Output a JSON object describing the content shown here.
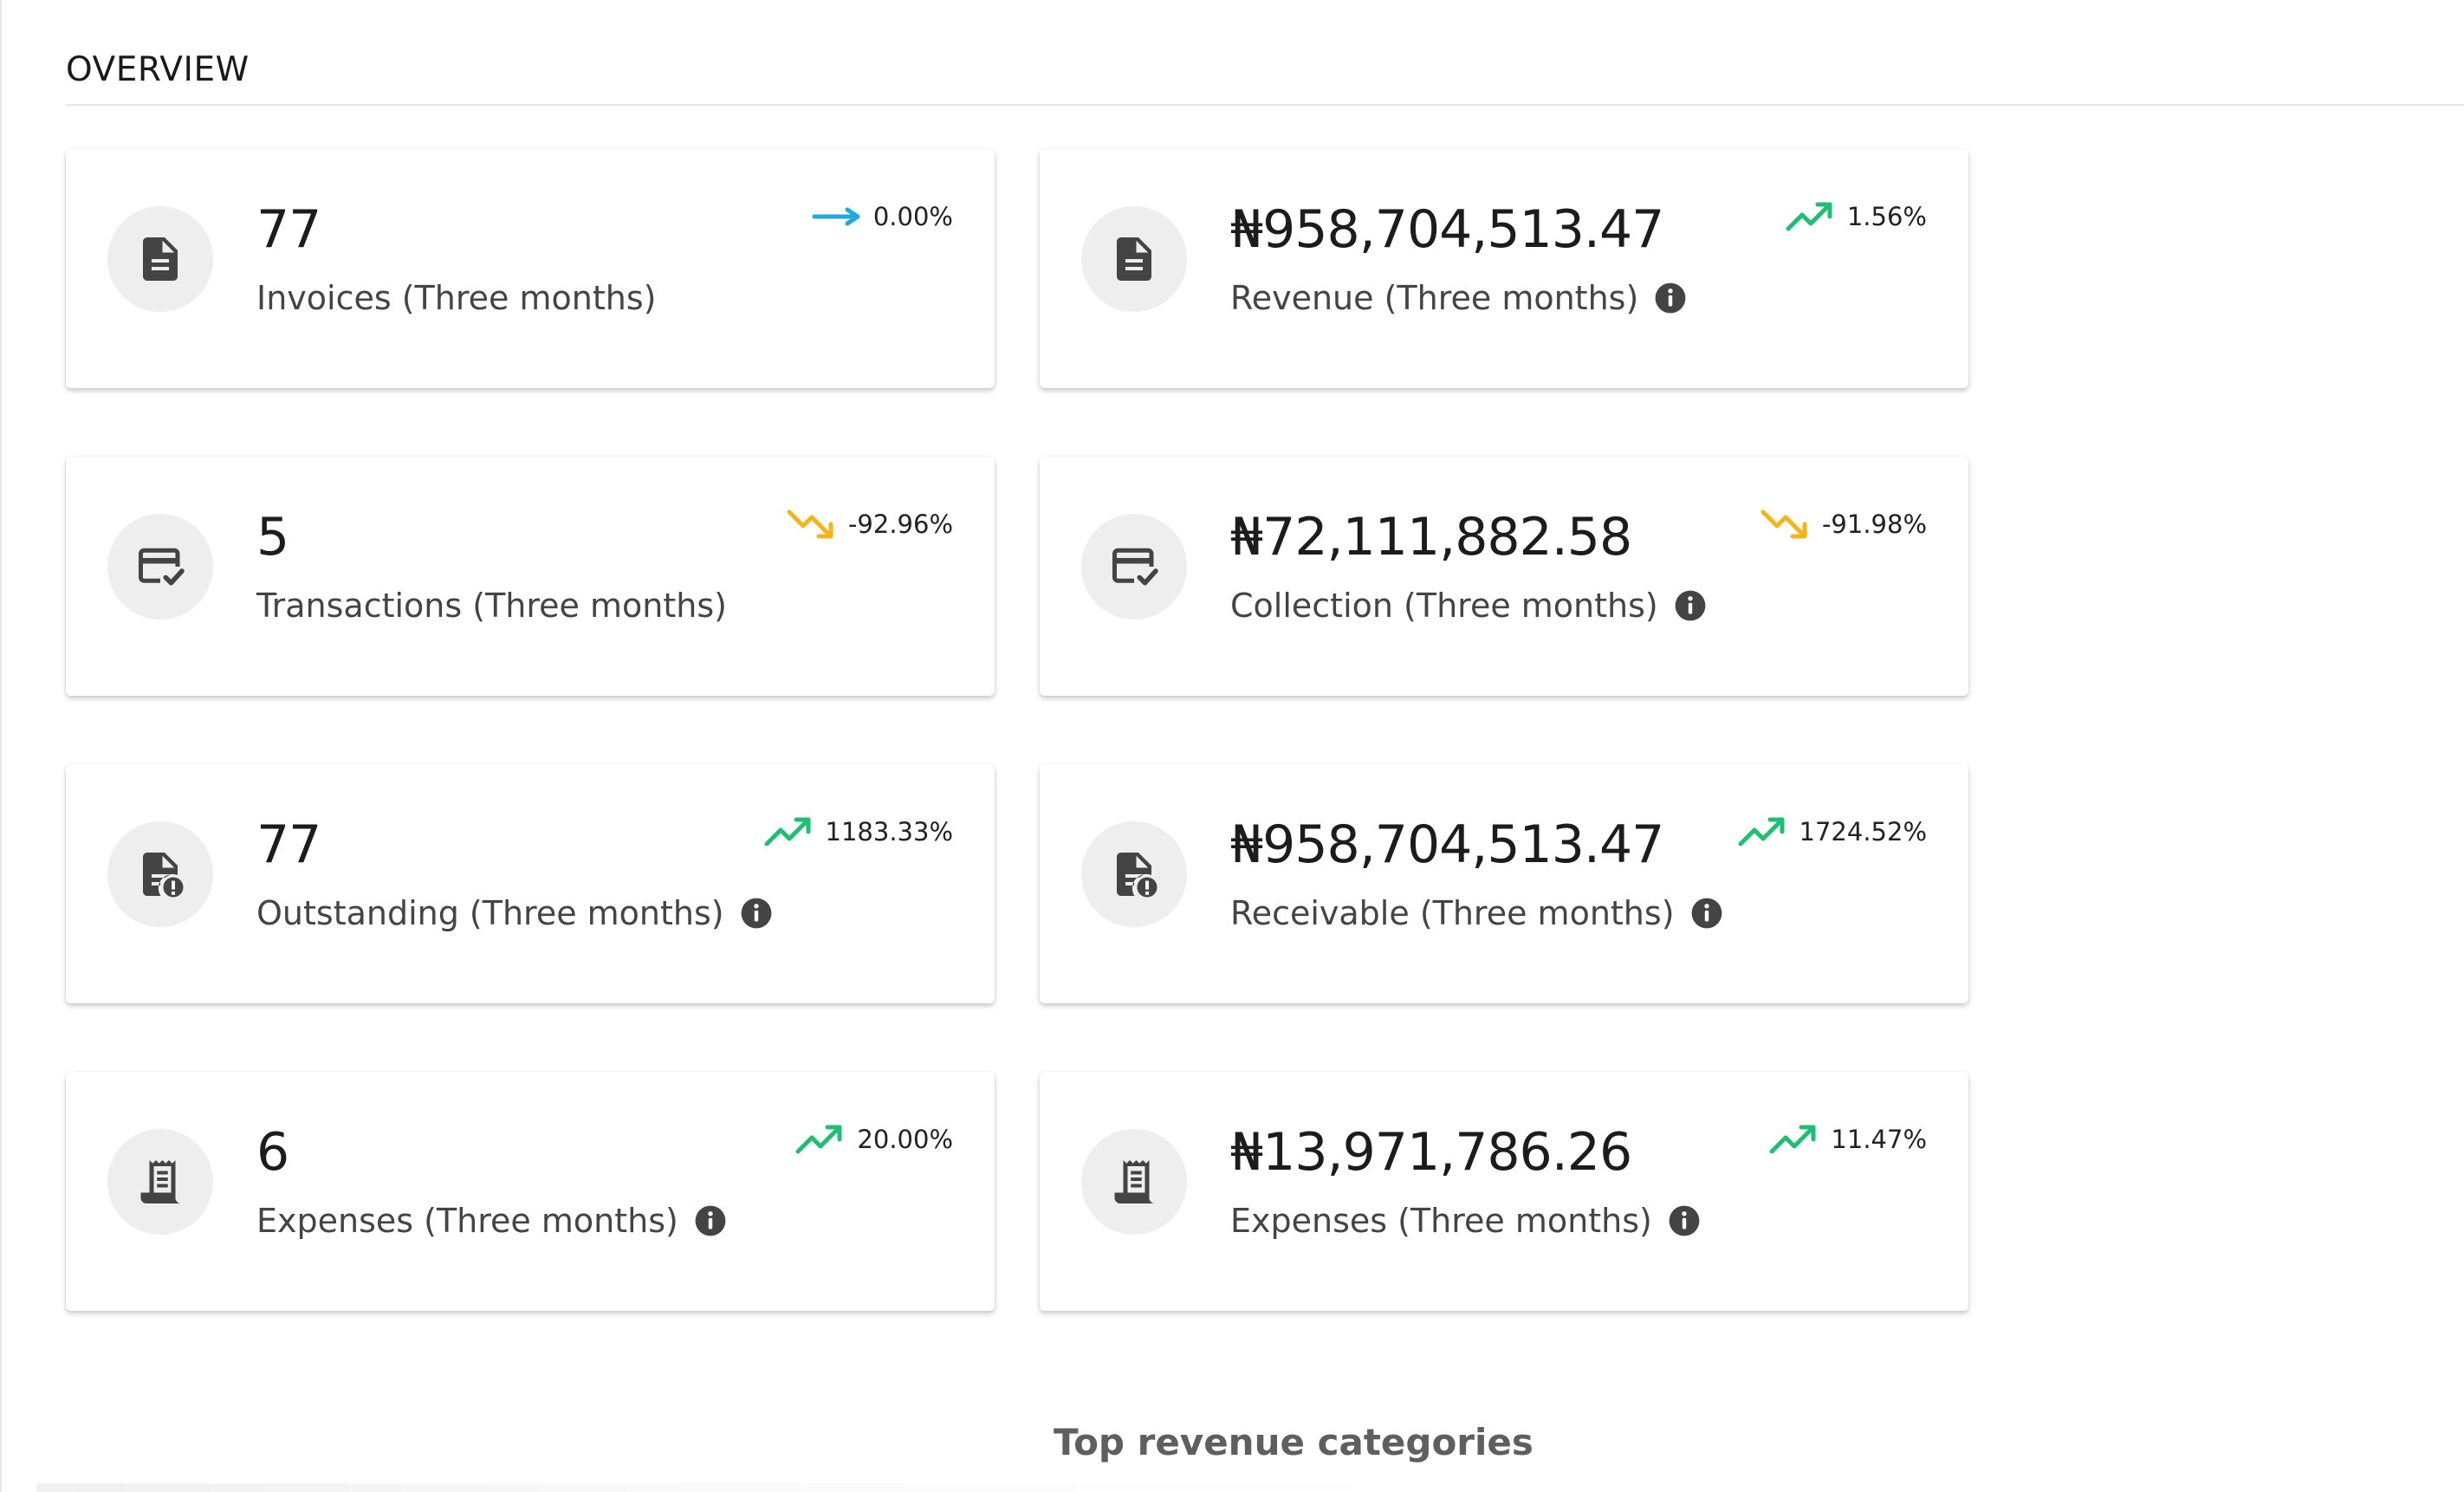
{
  "section": {
    "title": "OVERVIEW"
  },
  "colors": {
    "trend_flat": "#1fa9e0",
    "trend_up": "#1fbf73",
    "trend_down": "#f2b61b",
    "icon_fill": "#444444",
    "icon_bg": "#eeeeee"
  },
  "cards": [
    {
      "value": "77",
      "label": "Invoices (Three months)",
      "trend": "0.00%",
      "trend_dir": "flat",
      "icon": "document-icon",
      "info": false
    },
    {
      "value": "₦958,704,513.47",
      "label": "Revenue (Three months)",
      "trend": "1.56%",
      "trend_dir": "up",
      "icon": "document-icon",
      "info": true
    },
    {
      "value": "5",
      "label": "Transactions (Three months)",
      "trend": "-92.96%",
      "trend_dir": "down",
      "icon": "card-check-icon",
      "info": false
    },
    {
      "value": "₦72,111,882.58",
      "label": "Collection (Three months)",
      "trend": "-91.98%",
      "trend_dir": "down",
      "icon": "card-check-icon",
      "info": true
    },
    {
      "value": "77",
      "label": "Outstanding (Three months)",
      "trend": "1183.33%",
      "trend_dir": "up",
      "icon": "document-alert-icon",
      "info": true
    },
    {
      "value": "₦958,704,513.47",
      "label": "Receivable (Three months)",
      "trend": "1724.52%",
      "trend_dir": "up",
      "icon": "document-alert-icon",
      "info": true
    },
    {
      "value": "6",
      "label": "Expenses (Three months)",
      "trend": "20.00%",
      "trend_dir": "up",
      "icon": "receipt-icon",
      "info": true
    },
    {
      "value": "₦13,971,786.26",
      "label": "Expenses (Three months)",
      "trend": "11.47%",
      "trend_dir": "up",
      "icon": "receipt-icon",
      "info": true
    }
  ],
  "footer": {
    "title": "Top revenue categories"
  }
}
